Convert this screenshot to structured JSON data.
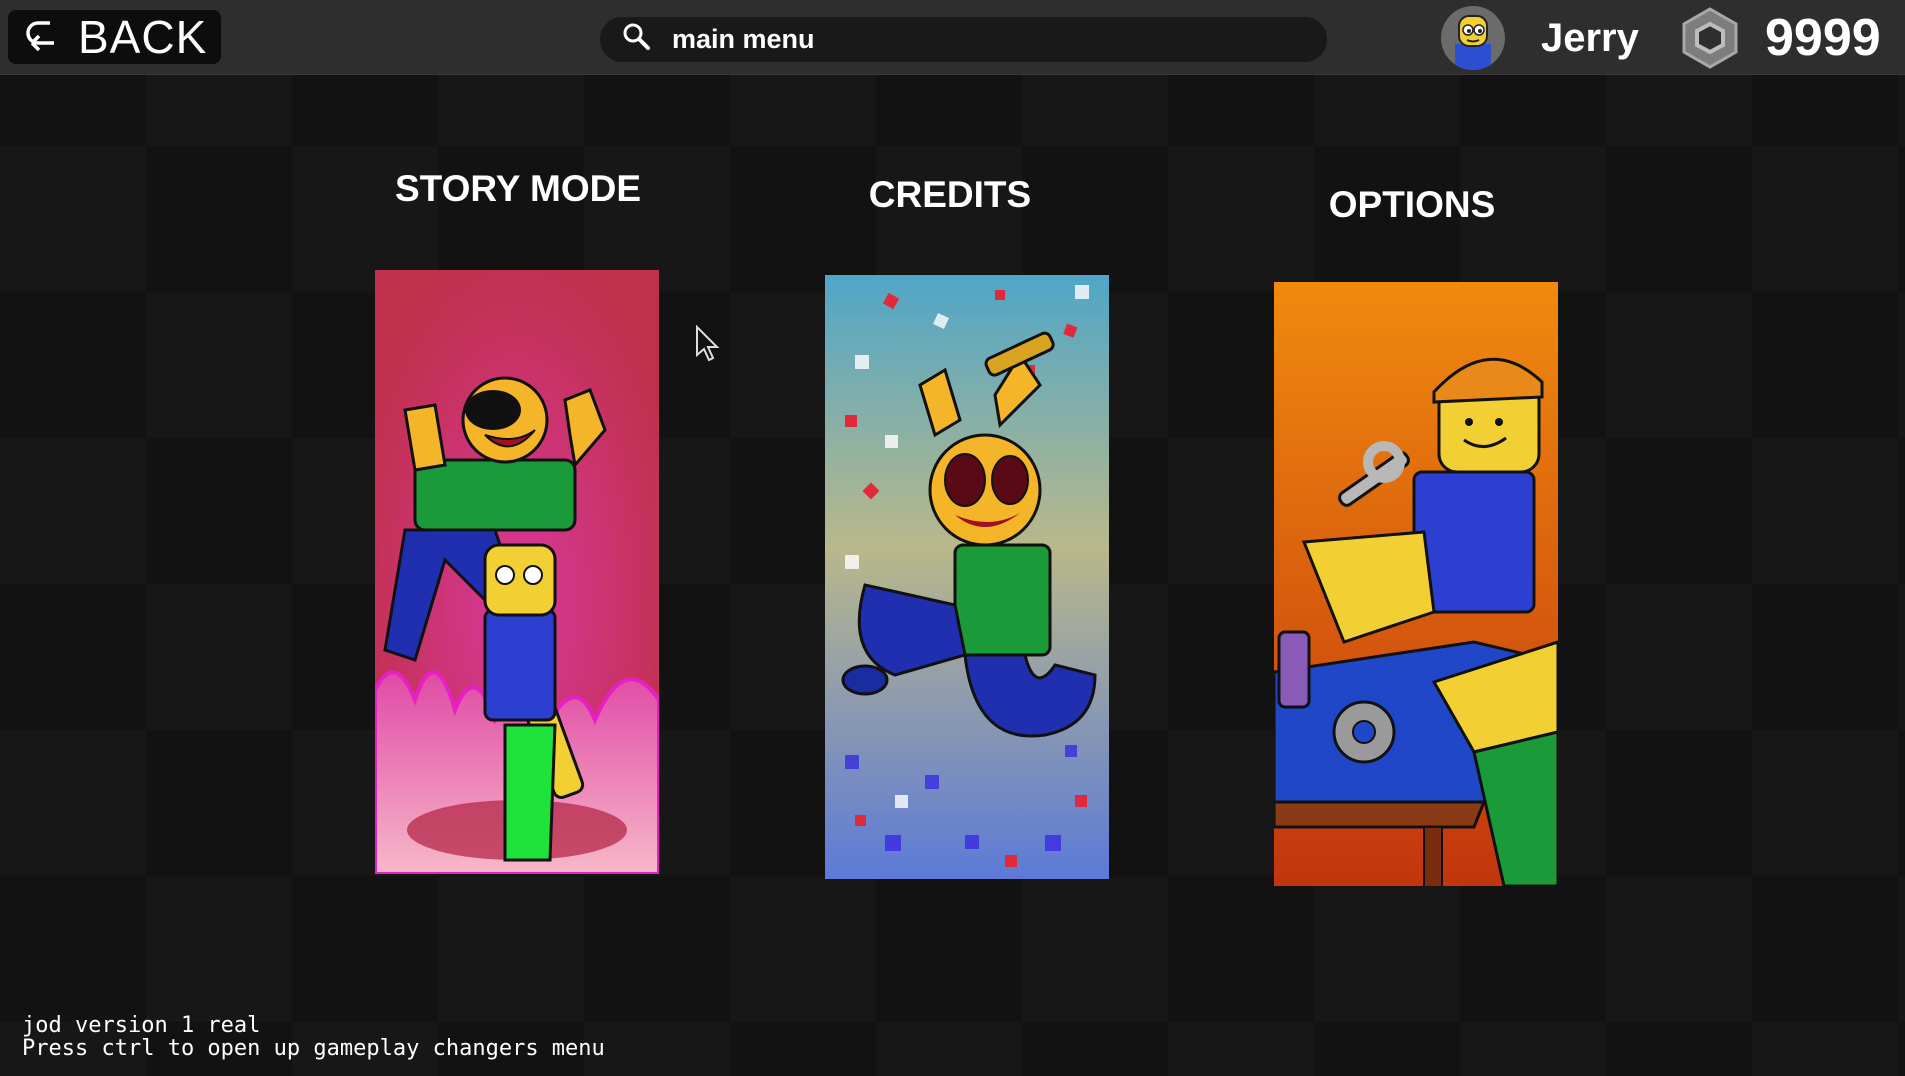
{
  "topbar": {
    "back_label": "BACK",
    "search_text": "main menu",
    "username": "Jerry",
    "currency": "9999"
  },
  "menu": {
    "items": [
      {
        "label": "STORY MODE"
      },
      {
        "label": "CREDITS"
      },
      {
        "label": "OPTIONS"
      }
    ]
  },
  "footer": {
    "line1": "jod version 1 real",
    "line2": "Press ctrl to open up gameplay changers menu"
  },
  "colors": {
    "topbar": "#2e2e2e",
    "story_bg": "#c0304a",
    "credits_bg": "#5aa3c8",
    "options_bg": "#f08a0e"
  },
  "icons": [
    "back-arrow-icon",
    "search-icon",
    "robux-icon",
    "cursor-icon"
  ]
}
